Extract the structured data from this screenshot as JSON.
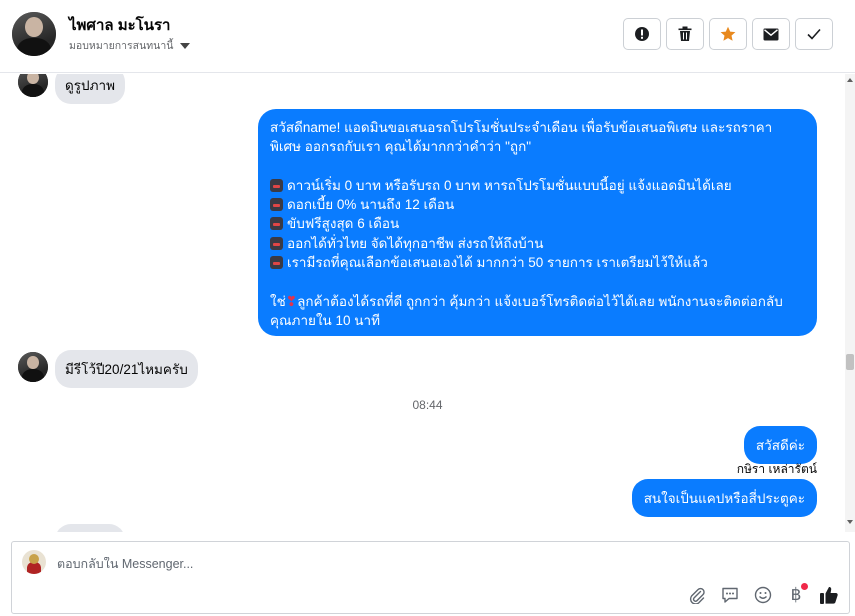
{
  "header": {
    "contact_name": "ไพศาล มะโนรา",
    "assign_label": "มอบหมายการสนทนานี้",
    "actions": [
      {
        "name": "spam-button",
        "icon": "exclamation-circle-icon"
      },
      {
        "name": "delete-button",
        "icon": "trash-icon"
      },
      {
        "name": "star-button",
        "icon": "star-icon",
        "color": "#e8891e"
      },
      {
        "name": "mark-unread-button",
        "icon": "envelope-icon"
      },
      {
        "name": "mark-done-button",
        "icon": "check-icon"
      }
    ]
  },
  "messages": {
    "incoming_top": "ดูรูปภาพ",
    "outgoing_promo": {
      "line1": "สวัสดีname! แอดมินขอเสนอรถโปรโมชั่นประจำเดือน เพื่อรับข้อเสนอพิเศษ และรถราคา",
      "line2": "พิเศษ ออกรถกับเรา คุณได้มากกว่าคำว่า \"ถูก\"",
      "bullets": [
        "ดาวน์เริ่ม 0 บาท หรือรับรถ 0 บาท หารถโปรโมชั่นแบบนี้อยู่ แจ้งแอดมินได้เลย",
        "ดอกเบี้ย 0% นานถึง 12 เดือน",
        "ขับฟรีสูงสุด 6 เดือน",
        "ออกได้ทั่วไทย จัดได้ทุกอาชีพ ส่งรถให้ถึงบ้าน",
        "เรามีรถที่คุณเลือกข้อเสนอเองได้ มากกว่า 50 รายการ เราเตรียมไว้ให้แล้ว"
      ],
      "closing_pre": "ใช่",
      "closing_emoji": "❣",
      "closing_line1": "ลูกค้าต้องได้รถที่ดี ถูกกว่า คุ้มกว่า แจ้งเบอร์โทรติดต่อไว้ได้เลย พนักงานจะติดต่อกลับ",
      "closing_line2": "คุณภายใน 10 นาที"
    },
    "incoming_question": "มีรีโว้ปี20/21ไหมครับ",
    "timestamp": "08:44",
    "outgoing_hello": "สวัสดีค่ะ",
    "sender_name": "กษิรา เหล่ารัตน์",
    "outgoing_ask": "สนใจเป็นแคปหรือสี่ประตูคะ"
  },
  "composer": {
    "placeholder": "ตอบกลับใน Messenger...",
    "tools": [
      "paperclip-icon",
      "saved-reply-icon",
      "emoji-icon",
      "baht-icon",
      "thumbs-up-icon"
    ]
  },
  "colors": {
    "outgoing_bubble": "#0a7cff",
    "incoming_bubble": "#e4e6eb",
    "star": "#e8891e",
    "notification_dot": "#f02849"
  }
}
